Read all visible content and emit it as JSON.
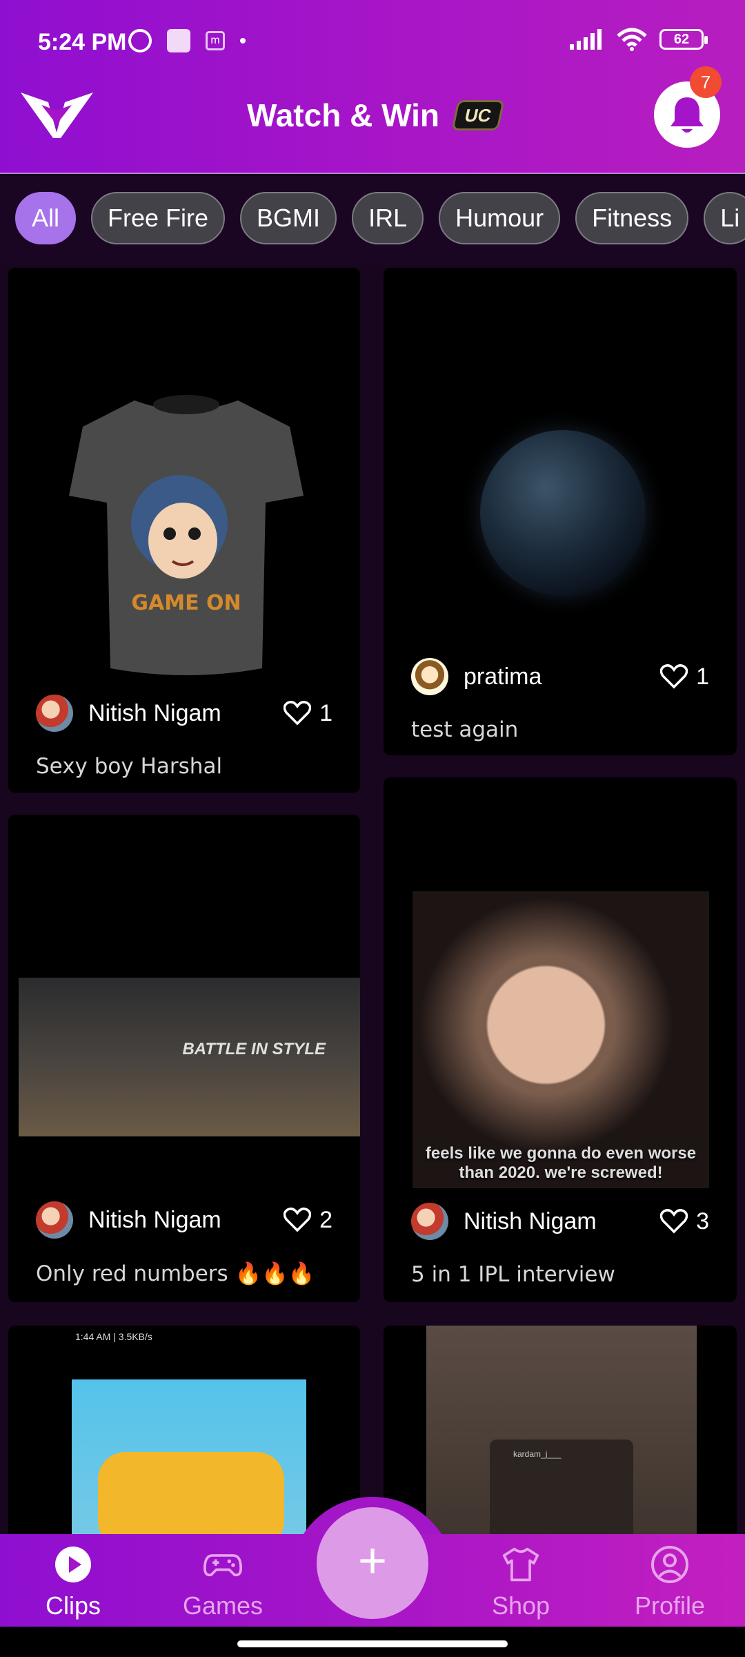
{
  "status_bar": {
    "time": "5:24 PM",
    "battery": "62",
    "m_label": "m"
  },
  "header": {
    "title": "Watch & Win",
    "badge_label": "UC",
    "notification_count": "7"
  },
  "categories": [
    "All",
    "Free Fire",
    "BGMI",
    "IRL",
    "Humour",
    "Fitness",
    "Li"
  ],
  "active_category": "All",
  "clips": [
    {
      "user": "Nitish Nigam",
      "likes": "1",
      "caption": "Sexy boy Harshal",
      "thumbnail": "tshirt",
      "shirt_text": "GAME ON"
    },
    {
      "user": "pratima",
      "likes": "1",
      "caption": "test again",
      "thumbnail": "earth"
    },
    {
      "user": "Nitish Nigam",
      "likes": "2",
      "caption": "Only red numbers 🔥🔥🔥",
      "thumbnail": "game-screenshot",
      "overlay_text": "BATTLE IN STYLE"
    },
    {
      "user": "Nitish Nigam",
      "likes": "3",
      "caption": "5 in 1 IPL interview",
      "thumbnail": "face",
      "subtitle": "feels like we gonna do even worse than 2020. we're screwed!"
    },
    {
      "thumbnail": "phone-screenshot",
      "overlay_text": "1:44 AM | 3.5KB/s"
    },
    {
      "thumbnail": "story-screenshot",
      "overlay_text": "kardam_j___"
    }
  ],
  "bottom_nav": {
    "items": [
      {
        "label": "Clips",
        "icon": "play-icon"
      },
      {
        "label": "Games",
        "icon": "gamepad-icon"
      },
      {
        "label": "Shop",
        "icon": "tshirt-icon"
      },
      {
        "label": "Profile",
        "icon": "profile-icon"
      }
    ],
    "fab_label": "+"
  },
  "colors": {
    "accent": "#a414c8",
    "chip_active": "#a673ea",
    "badge": "#f24b33"
  }
}
